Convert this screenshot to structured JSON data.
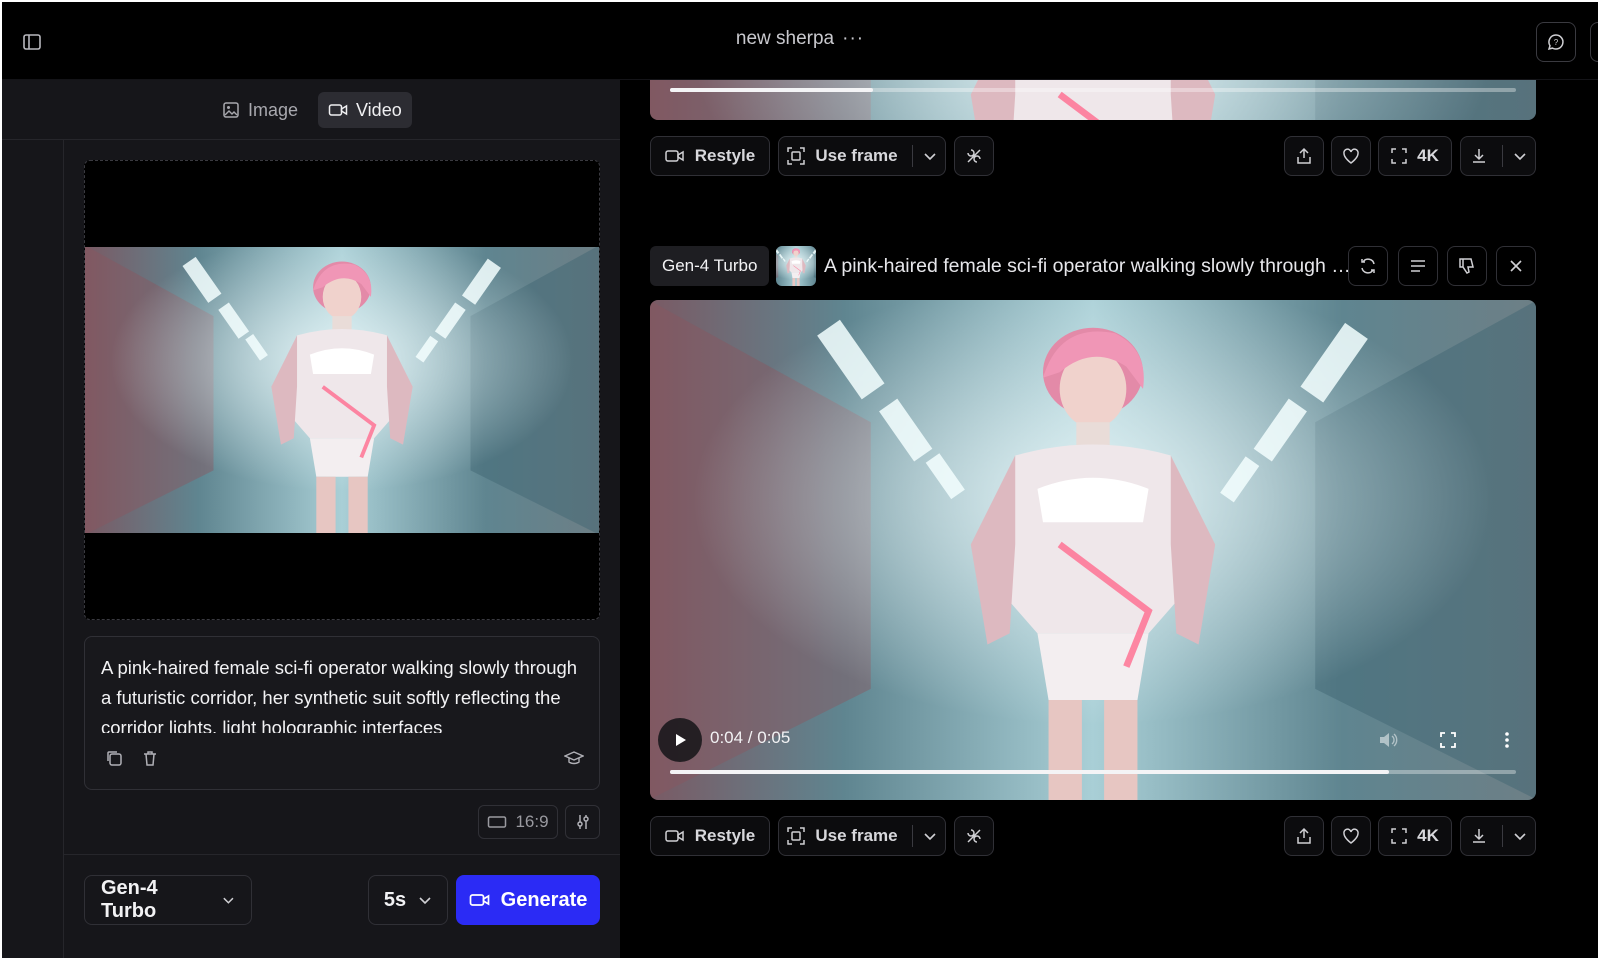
{
  "header": {
    "title": "new sherpa",
    "more": "···"
  },
  "modes": {
    "image": "Image",
    "video": "Video"
  },
  "prompt": {
    "text": "A pink-haired female sci-fi operator walking slowly through a futuristic corridor, her synthetic suit softly reflecting the corridor lights, light holographic interfaces"
  },
  "settings": {
    "ratio": "16:9",
    "model": "Gen-4 Turbo",
    "duration": "5s",
    "generate": "Generate"
  },
  "toolbar": {
    "restyle": "Restyle",
    "use_frame": "Use frame",
    "upscale": "4K"
  },
  "generation": {
    "model": "Gen-4 Turbo",
    "prompt": "A pink-haired female sci-fi operator walking slowly through a futuristic corridor, her synthetic suit softly reflecting the corridor lights",
    "time": "0:04 / 0:05"
  },
  "players": {
    "main_progress": 0.85,
    "top_progress": 0.24
  }
}
